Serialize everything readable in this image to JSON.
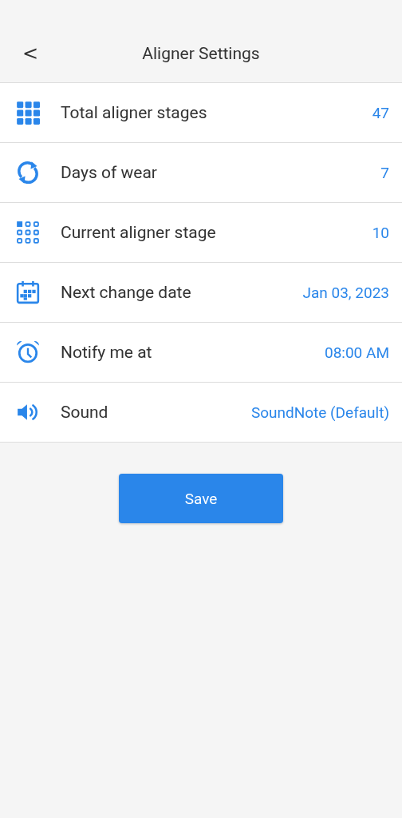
{
  "header": {
    "back": "<",
    "title": "Aligner Settings"
  },
  "settings": [
    {
      "kind": "grid",
      "label": "Total aligner stages",
      "value": "47"
    },
    {
      "kind": "cycle",
      "label": "Days of wear",
      "value": "7"
    },
    {
      "kind": "grid-outline",
      "label": "Current aligner stage",
      "value": "10"
    },
    {
      "kind": "calendar",
      "label": "Next change date",
      "value": "Jan 03, 2023"
    },
    {
      "kind": "alarm",
      "label": "Notify me at",
      "value": "08:00 AM"
    },
    {
      "kind": "speaker",
      "label": "Sound",
      "value": "SoundNote (Default)"
    }
  ],
  "save_button": "Save"
}
